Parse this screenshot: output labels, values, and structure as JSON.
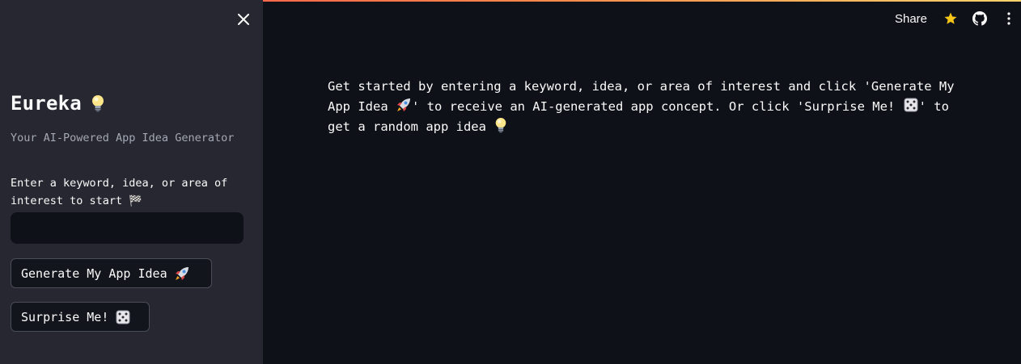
{
  "header": {
    "share_label": "Share",
    "icons": [
      "star-icon",
      "github-icon",
      "more-vertical-icon"
    ]
  },
  "sidebar": {
    "title": "Eureka",
    "title_icon": "lightbulb-icon",
    "subtitle": "Your AI-Powered App Idea Generator",
    "input_label": "Enter a keyword, idea, or area of interest to start 🏁",
    "input_value": "",
    "input_placeholder": "",
    "generate_label": "Generate My App Idea",
    "generate_icon": "rocket-icon",
    "surprise_label": "Surprise Me!",
    "surprise_icon": "dice-icon"
  },
  "main": {
    "intro_part1": "Get started by entering a keyword, idea, or area of interest and click 'Generate My App Idea",
    "intro_part2": "' to receive an AI-generated app concept. Or click 'Surprise Me!",
    "intro_part3": "' to get a random app idea"
  },
  "colors": {
    "main_bg": "#0e1117",
    "sidebar_bg": "#262730",
    "star": "#f5c518",
    "accent": "#ff4b4b"
  }
}
